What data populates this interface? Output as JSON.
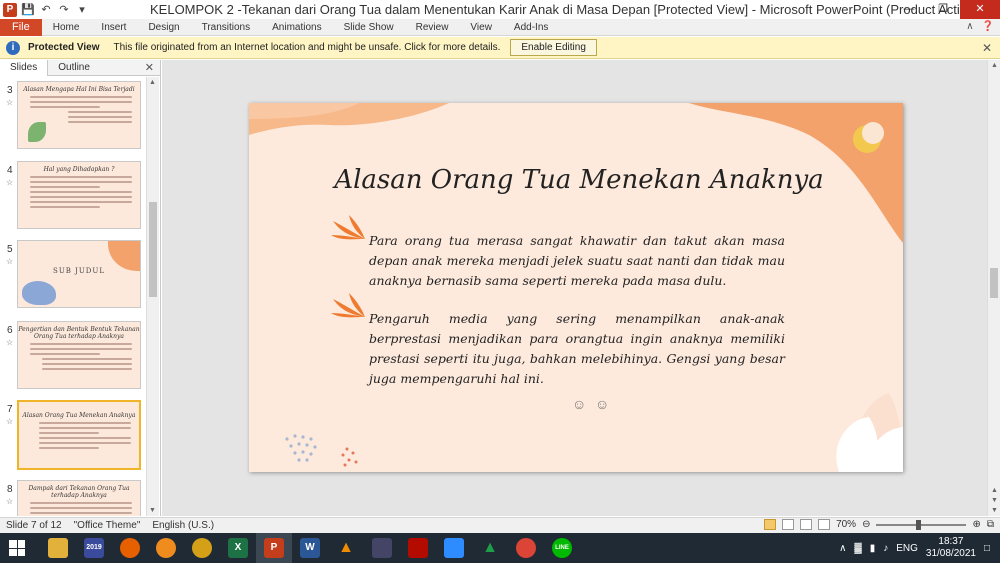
{
  "window": {
    "title": "KELOMPOK 2 -Tekanan dari Orang Tua dalam Menentukan Karir Anak di Masa Depan [Protected View]  -  Microsoft PowerPoint (Product Activation Failed)",
    "app_letter": "P"
  },
  "ribbon": {
    "file": "File",
    "tabs": [
      "Home",
      "Insert",
      "Design",
      "Transitions",
      "Animations",
      "Slide Show",
      "Review",
      "View",
      "Add-Ins"
    ]
  },
  "protected_bar": {
    "label": "Protected View",
    "message": "This file originated from an Internet location and might be unsafe. Click for more details.",
    "button": "Enable Editing"
  },
  "panel": {
    "tabs": [
      "Slides",
      "Outline"
    ],
    "thumbnails": [
      {
        "num": "3",
        "title": "Alasan Mengapa Hal Ini Bisa Terjadi"
      },
      {
        "num": "4",
        "title": "Hal yang Dihadapkan ?"
      },
      {
        "num": "5",
        "title": "SUB JUDUL"
      },
      {
        "num": "6",
        "title": "Pengertian dan Bentuk Bentuk Tekanan Orang Tua terhadap Anaknya"
      },
      {
        "num": "7",
        "title": "Alasan Orang Tua Menekan Anaknya"
      },
      {
        "num": "8",
        "title": "Dampak dari Tekanan Orang Tua terhadap Anaknya"
      }
    ]
  },
  "slide": {
    "title": "Alasan Orang Tua Menekan Anaknya",
    "paragraphs": [
      "Para orang tua merasa sangat khawatir dan takut akan masa depan anak mereka menjadi jelek suatu saat nanti dan tidak mau anaknya bernasib sama seperti mereka pada masa dulu.",
      "Pengaruh media yang sering menampilkan anak-anak berprestasi menjadikan para orangtua ingin anaknya memiliki prestasi seperti itu juga, bahkan melebihinya. Gengsi yang besar juga mempengaruhi hal ini."
    ]
  },
  "status": {
    "slide_info": "Slide 7 of 12",
    "theme": "\"Office Theme\"",
    "language": "English (U.S.)",
    "zoom": "70%"
  },
  "taskbar": {
    "apps": [
      {
        "name": "file-explorer",
        "label": "",
        "color": "#e2b13c"
      },
      {
        "name": "calendar-2019",
        "label": "2019",
        "color": "#3a4a9c"
      },
      {
        "name": "firefox",
        "label": "",
        "color": "#e66000"
      },
      {
        "name": "media-orb",
        "label": "",
        "color": "#f08c1e"
      },
      {
        "name": "headphones",
        "label": "",
        "color": "#d4a017"
      },
      {
        "name": "excel",
        "label": "X",
        "color": "#1d7245"
      },
      {
        "name": "powerpoint",
        "label": "P",
        "color": "#c43e1c"
      },
      {
        "name": "word",
        "label": "W",
        "color": "#2b5797"
      },
      {
        "name": "vlc",
        "label": "",
        "color": "#f08c00"
      },
      {
        "name": "video-editor",
        "label": "",
        "color": "#444466"
      },
      {
        "name": "acrobat",
        "label": "",
        "color": "#b30b00"
      },
      {
        "name": "zoom",
        "label": "",
        "color": "#2d8cff"
      },
      {
        "name": "sheets-triangle",
        "label": "",
        "color": "#1e9e49"
      },
      {
        "name": "chrome",
        "label": "",
        "color": "#db4437"
      },
      {
        "name": "line",
        "label": "LINE",
        "color": "#00b900"
      }
    ],
    "language": "ENG",
    "time": "18:37",
    "date": "31/08/2021"
  },
  "colors": {
    "accent_orange": "#f4a26c",
    "leaf_orange": "#ee7b30",
    "slide_bg": "#fdeadd",
    "file_tab": "#d24726"
  }
}
